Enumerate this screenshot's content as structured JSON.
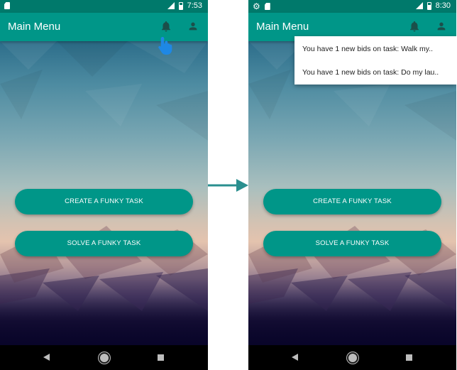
{
  "left_screen": {
    "status_time": "7:53",
    "app_title": "Main Menu",
    "buttons": {
      "create": "CREATE A FUNKY TASK",
      "solve": "SOLVE A FUNKY TASK"
    }
  },
  "right_screen": {
    "status_time": "8:30",
    "app_title": "Main Menu",
    "notifications": [
      "You have 1 new bids on task: Walk my..",
      "You have 1 new bids on task: Do my lau.."
    ],
    "buttons": {
      "create": "CREATE A FUNKY TASK",
      "solve": "SOLVE A FUNKY TASK"
    }
  },
  "colors": {
    "primary": "#009688",
    "primary_dark": "#00796b",
    "arrow": "#2a8f8f",
    "tap_hand": "#1e88e5"
  },
  "icons": [
    "sd-card-icon",
    "settings-icon",
    "signal-icon",
    "battery-icon",
    "bell-icon",
    "person-icon",
    "book-icon",
    "back-icon",
    "home-icon",
    "recents-icon",
    "tap-hand-icon",
    "transition-arrow-icon"
  ]
}
